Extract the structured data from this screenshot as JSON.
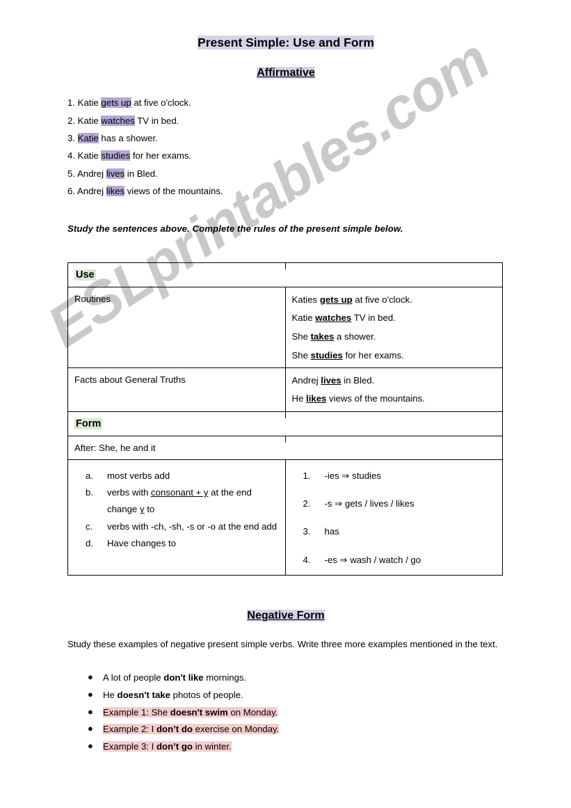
{
  "document": {
    "title": "Present Simple: Use and Form",
    "affirmative_heading": "Affirmative",
    "instruction": "Study the sentences above. Complete the rules of the present simple below.",
    "watermark": "ESLprintables.com"
  },
  "colors": {
    "purple_highlight": "#b4a7d6",
    "lavender_highlight": "#d9d2e9",
    "green_highlight": "#d9ead3",
    "pink_highlight": "#f4cccc",
    "watermark": "#c9c9c9",
    "table_border": "#000000"
  },
  "affirmative_sentences": [
    {
      "number": "1.",
      "before": "Katie ",
      "highlight": "gets up",
      "after": " at five o'clock."
    },
    {
      "number": "2.",
      "before": "Katie ",
      "highlight": "watches",
      "after": " TV in bed."
    },
    {
      "number": "3.",
      "before": "",
      "highlight": "Katie",
      "after": " has a shower."
    },
    {
      "number": "4.",
      "before": "Katie ",
      "highlight": "studies",
      "after": " for her exams."
    },
    {
      "number": "5.",
      "before": "Andrej ",
      "highlight": "lives",
      "after": " in Bled."
    },
    {
      "number": "6.",
      "before": "Andrej ",
      "highlight": "likes",
      "after": " views of the mountains."
    }
  ],
  "table": {
    "use_header": "Use",
    "form_header": "Form",
    "rows": [
      {
        "label": "Routines",
        "examples": [
          {
            "before": "Katies ",
            "bold": "gets up",
            "after": " at five o'clock."
          },
          {
            "before": "Katie ",
            "bold": "watches",
            "after": " TV in bed."
          },
          {
            "before": "She ",
            "bold": "takes",
            "after": " a shower."
          },
          {
            "before": "She ",
            "bold": "studies",
            "after": " for her exams."
          }
        ]
      },
      {
        "label": "Facts about General Truths",
        "examples": [
          {
            "before": "Andrej ",
            "bold": "lives",
            "after": " in Bled."
          },
          {
            "before": "He ",
            "bold": "likes",
            "after": " views of the mountains."
          }
        ]
      }
    ],
    "after_row": "After: She, he and it",
    "rules": [
      {
        "marker": "a.",
        "text_before": "most verbs add",
        "underlined": "",
        "text_after": ""
      },
      {
        "marker": "b.",
        "text_before": "verbs with ",
        "underlined": "consonant + y",
        "text_after": " at the end change ",
        "underlined2": "y",
        "text_after2": " to"
      },
      {
        "marker": "c.",
        "text_before": "verbs with -ch, -sh, -s or -o at the end add",
        "underlined": "",
        "text_after": ""
      },
      {
        "marker": "d.",
        "text_before": "Have changes to",
        "underlined": "",
        "text_after": ""
      }
    ],
    "answers": [
      {
        "marker": "1.",
        "text": "-ies ⇒ studies"
      },
      {
        "marker": "2.",
        "text": "-s ⇒ gets / lives / likes"
      },
      {
        "marker": "3.",
        "text": "has"
      },
      {
        "marker": "4.",
        "text": "-es ⇒ wash / watch / go"
      }
    ]
  },
  "negative": {
    "heading": "Negative Form",
    "intro": "Study these examples of negative present simple verbs. Write three more examples mentioned in the text.",
    "items": [
      {
        "highlighted": false,
        "before": "A lot of people ",
        "bold": "don't like",
        "after": " mornings."
      },
      {
        "highlighted": false,
        "before": " He ",
        "bold": "doesn't take",
        "after": " photos of people."
      },
      {
        "highlighted": true,
        "before": "Example 1: She ",
        "bold": "doesn't swim",
        "after": " on Monday."
      },
      {
        "highlighted": true,
        "before": "Example 2: I ",
        "bold": "don’t do",
        "after": " exercise on Monday."
      },
      {
        "highlighted": true,
        "before": "Example 3: I ",
        "bold": "don’t go",
        "after": " in winter."
      }
    ]
  }
}
